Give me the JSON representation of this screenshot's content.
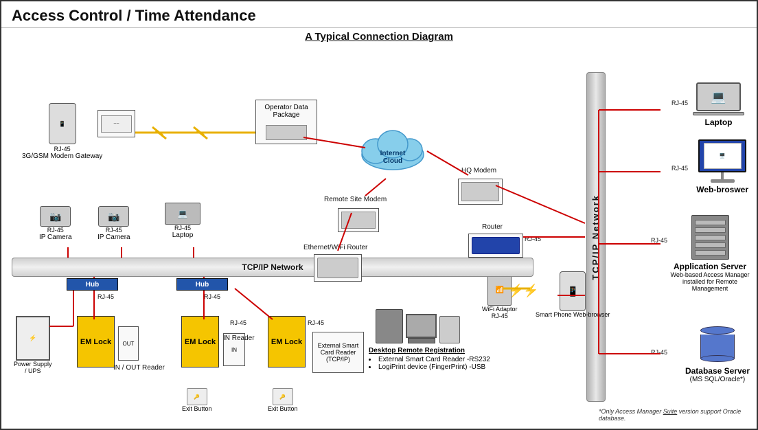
{
  "page": {
    "title": "Access Control / Time Attendance",
    "diagram_title": "A Typical Connection Diagram"
  },
  "colors": {
    "line_red": "#cc0000",
    "line_yellow": "#e8b000",
    "bar_gray": "#c0c0c0",
    "bar_blue": "#2255aa",
    "box_yellow": "#f5c500",
    "text_dark": "#111111"
  },
  "labels": {
    "rj45": "RJ-45",
    "tcp_ip_network": "TCP/IP Network",
    "tcp_ip_vertical": "T\nC\nP\n/\nI\nP\n \nN\ne\nt\nw\no\nr\nk",
    "internet_cloud": "Internet\nCloud",
    "operator_data_package": "Operator\nData Package",
    "remote_site_modem": "Remote Site Modem",
    "hq_modem": "HQ Modem",
    "router": "Router",
    "ethernet_wifi_router": "Ethernet/WiFi Router",
    "hub1": "Hub",
    "hub2": "Hub",
    "threeg_gsm": "3G/GSM Modem\nGateway",
    "ip_camera1": "IP Camera",
    "ip_camera2": "IP Camera",
    "laptop_top": "Laptop",
    "power_supply": "Power Supply\n/ UPS",
    "em_lock1": "EM Lock",
    "em_lock2": "EM Lock",
    "em_lock3": "EM Lock",
    "in_out_reader": "IN / OUT\nReader",
    "in_reader": "IN\nReader",
    "exit_button1": "Exit Button",
    "exit_button2": "Exit Button",
    "ext_smart_card_reader": "External Smart\nCard Reader\n(TCP/IP)",
    "desktop_remote": "Desktop Remote Registration",
    "desktop_bullet1": "External Smart Card Reader -RS232",
    "desktop_bullet2": "LogiPrint device (FingerPrint) -USB",
    "wifi_adaptor": "WiFi\nAdaptor",
    "smart_phone": "Smart Phone\nWeb-browser",
    "laptop_right": "Laptop",
    "web_browser": "Web-broswer",
    "app_server": "Application Server",
    "app_server_sub": "Web-based Access Manager\ninstalled for Remote Management",
    "db_server": "Database Server",
    "db_server_sub": "(MS SQL/Oracle*)",
    "footnote": "*Only Access Manager Suite version support Oracle database."
  }
}
